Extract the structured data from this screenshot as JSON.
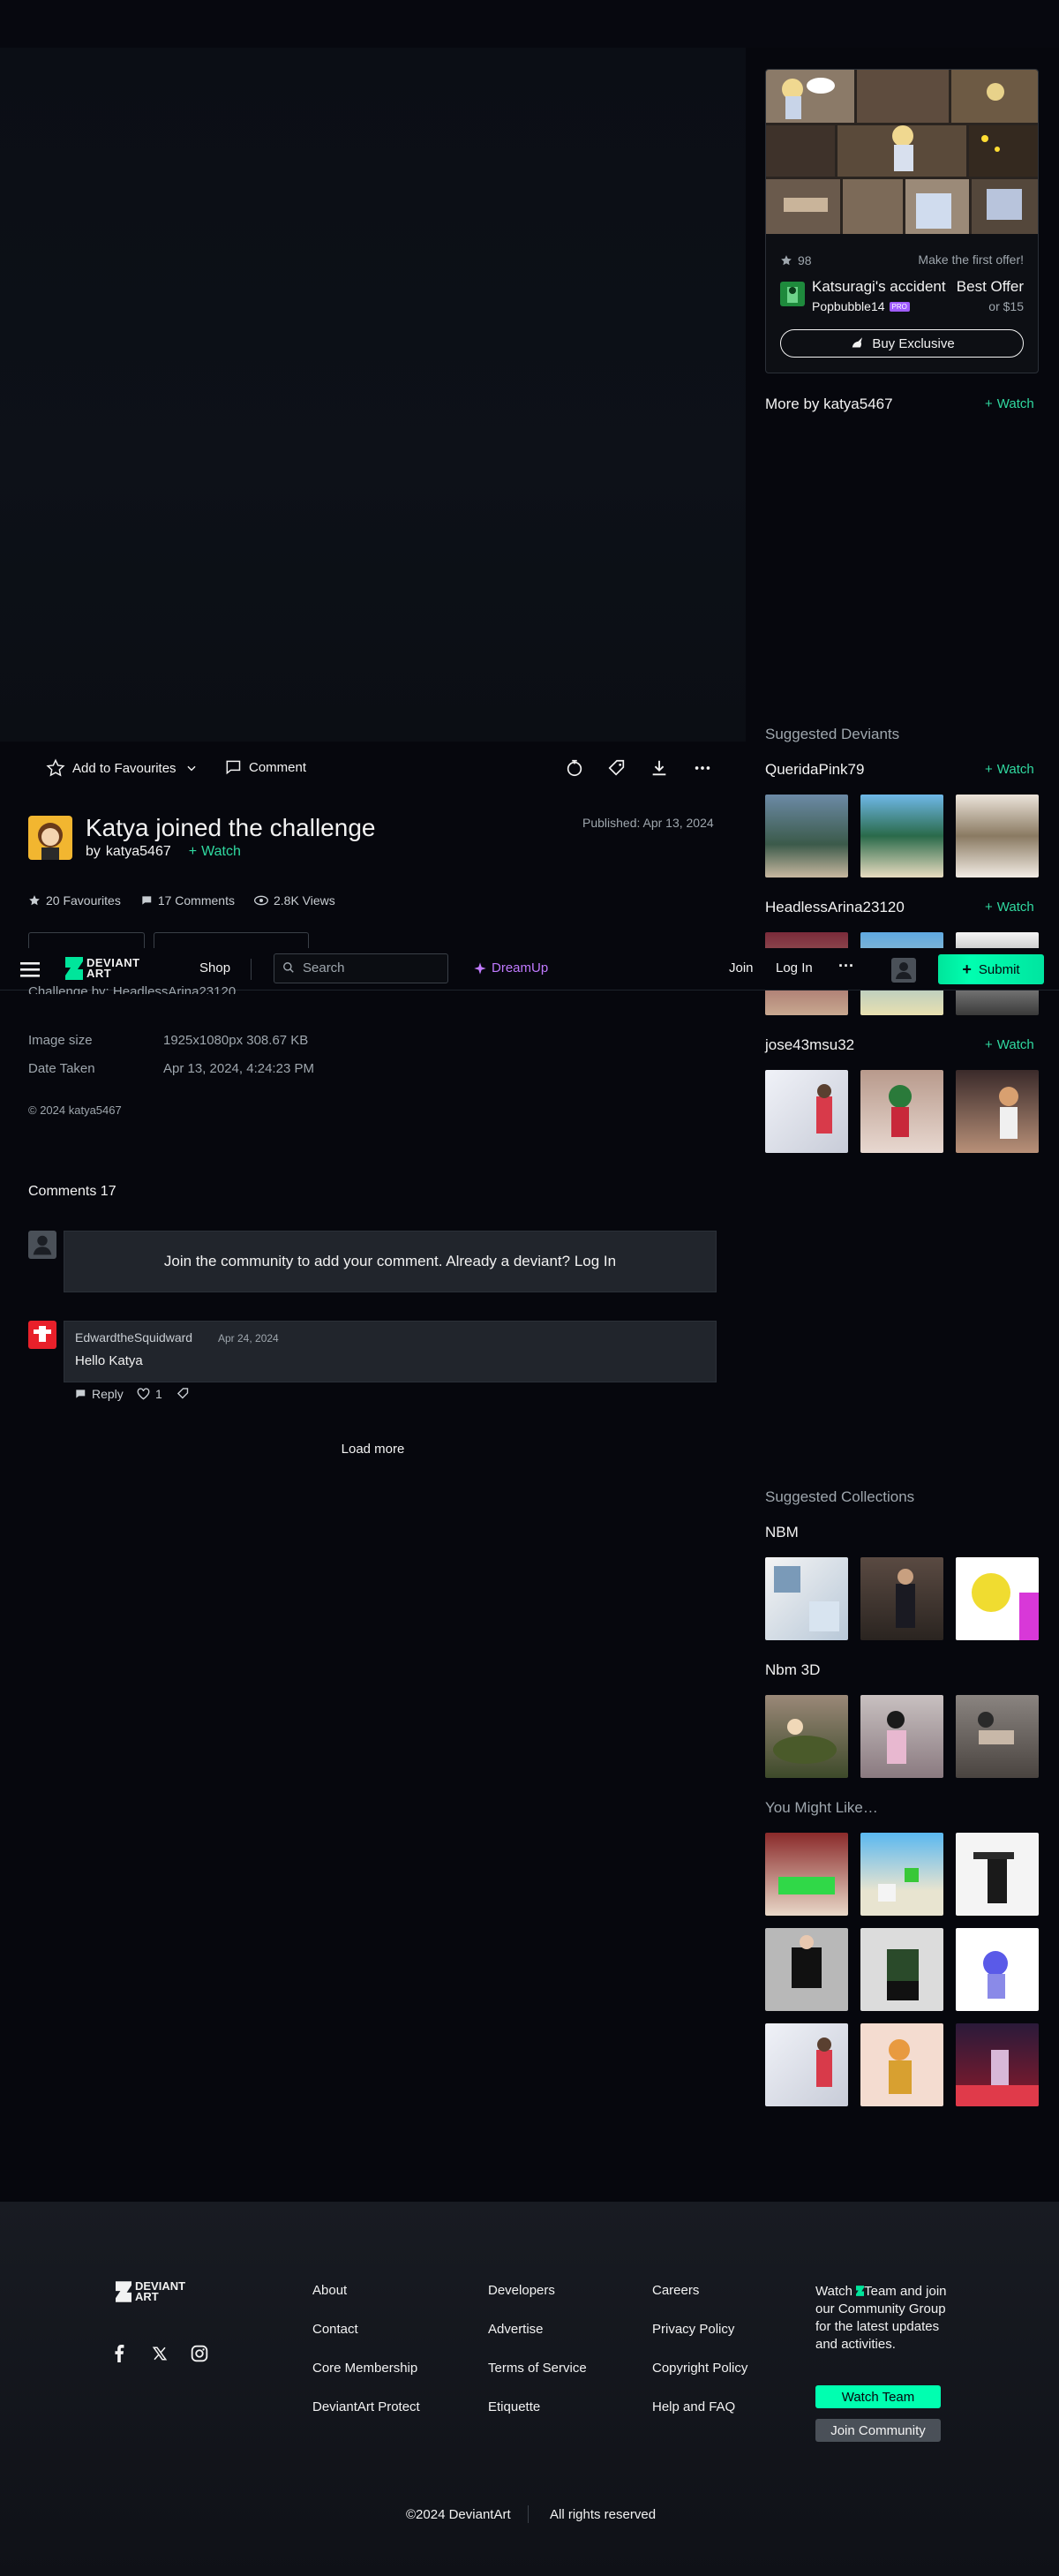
{
  "colors": {
    "accent": "#30d9a0",
    "submit": "#00ffb0",
    "core_badge": "#a05cff",
    "bg": "#06070d"
  },
  "promo": {
    "favourites": "98",
    "offer_text": "Make the first offer!",
    "title": "Katsuragi's accident",
    "price_label": "Best Offer",
    "price_alt": "or $15",
    "author": "Popbubble14",
    "author_badge": "PRO",
    "buy_label": "Buy Exclusive"
  },
  "more_by": {
    "label": "More by katya5467",
    "watch": "Watch"
  },
  "suggested_deviants": {
    "heading": "Suggested Deviants",
    "items": [
      {
        "name": "QueridaPink79",
        "watch": "Watch"
      },
      {
        "name": "HeadlessArina23120",
        "watch": "Watch"
      },
      {
        "name": "jose43msu32",
        "watch": "Watch"
      }
    ]
  },
  "actions": {
    "add_favourites": "Add to Favourites",
    "comment": "Comment"
  },
  "deviation": {
    "title": "Katya joined the challenge",
    "by": "by",
    "author": "katya5467",
    "watch": "Watch",
    "published": "Published: Apr 13, 2024",
    "favourites": "20 Favourites",
    "comments": "17 Comments",
    "views": "2.8K Views",
    "challenge_text": "Challenge by: HeadlessArina23120",
    "details": [
      {
        "label": "Image size",
        "value": "1925x1080px 308.67 KB"
      },
      {
        "label": "Date Taken",
        "value": "Apr 13, 2024, 4:24:23 PM"
      }
    ],
    "copyright": "© 2024 katya5467"
  },
  "nav": {
    "logo": "DEVIANT ART",
    "shop": "Shop",
    "search_placeholder": "Search",
    "dreamup": "DreamUp",
    "join": "Join",
    "login": "Log In",
    "more": "···",
    "submit": "Submit"
  },
  "comments": {
    "heading": "Comments 17",
    "join_prompt": "Join the community to add your comment. Already a deviant? Log In",
    "items": [
      {
        "author": "EdwardtheSquidward",
        "date": "Apr 24, 2024",
        "text": "Hello Katya",
        "reply": "Reply",
        "likes": "1"
      }
    ],
    "load_more": "Load more"
  },
  "suggested_collections": {
    "heading": "Suggested Collections",
    "items": [
      {
        "name": "NBM"
      },
      {
        "name": "Nbm 3D"
      }
    ]
  },
  "you_might_like": {
    "heading": "You Might Like…"
  },
  "footer": {
    "logo": "DEVIANT ART",
    "col1": [
      "About",
      "Contact",
      "Core Membership",
      "DeviantArt Protect"
    ],
    "col2": [
      "Developers",
      "Advertise",
      "Terms of Service",
      "Etiquette"
    ],
    "col3": [
      "Careers",
      "Privacy Policy",
      "Copyright Policy",
      "Help and FAQ"
    ],
    "watch_text_1": "Watch",
    "watch_text_2": "Team and join our Community Group for the latest updates and activities.",
    "watch_team": "Watch Team",
    "join_community": "Join Community",
    "copyright": "©2024 DeviantArt",
    "rights": "All rights reserved"
  }
}
